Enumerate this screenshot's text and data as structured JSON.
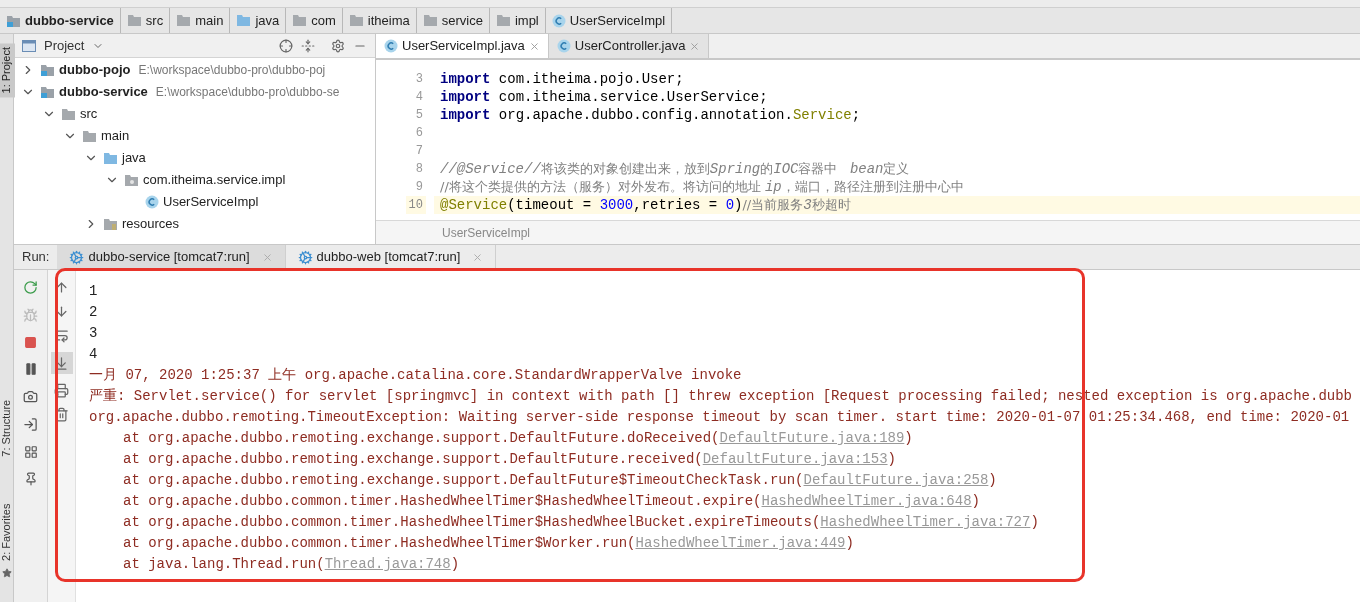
{
  "breadcrumb": [
    {
      "label": "dubbo-service",
      "kind": "module"
    },
    {
      "label": "src",
      "kind": "folder"
    },
    {
      "label": "main",
      "kind": "folder"
    },
    {
      "label": "java",
      "kind": "source"
    },
    {
      "label": "com",
      "kind": "folder"
    },
    {
      "label": "itheima",
      "kind": "folder"
    },
    {
      "label": "service",
      "kind": "folder"
    },
    {
      "label": "impl",
      "kind": "folder"
    },
    {
      "label": "UserServiceImpl",
      "kind": "class"
    }
  ],
  "tool_stripe": [
    {
      "label": "1: Project",
      "selected": true
    },
    {
      "label": "7: Structure",
      "selected": false
    },
    {
      "label": "2: Favorites",
      "selected": false
    }
  ],
  "project": {
    "title": "Project",
    "tree": [
      {
        "label": "dubbo-pojo",
        "path": "E:\\workspace\\dubbo-pro\\dubbo-poj",
        "kind": "module",
        "expanded": false
      },
      {
        "label": "dubbo-service",
        "path": "E:\\workspace\\dubbo-pro\\dubbo-se",
        "kind": "module",
        "expanded": true,
        "children": [
          {
            "label": "src",
            "kind": "folder",
            "expanded": true,
            "children": [
              {
                "label": "main",
                "kind": "folder",
                "expanded": true,
                "children": [
                  {
                    "label": "java",
                    "kind": "source",
                    "expanded": true,
                    "children": [
                      {
                        "label": "com.itheima.service.impl",
                        "kind": "package",
                        "expanded": true,
                        "children": [
                          {
                            "label": "UserServiceImpl",
                            "kind": "class"
                          }
                        ]
                      }
                    ]
                  },
                  {
                    "label": "resources",
                    "kind": "resources",
                    "expanded": false
                  }
                ]
              }
            ]
          }
        ]
      }
    ]
  },
  "editor": {
    "tabs": [
      {
        "label": "UserServiceImpl.java",
        "selected": true
      },
      {
        "label": "UserController.java",
        "selected": false
      }
    ],
    "lines": [
      {
        "number": "3",
        "current": false,
        "segments": [
          {
            "text": "import",
            "kind": "keyword"
          },
          {
            "text": " com.itheima.pojo.User;",
            "kind": "plain"
          }
        ]
      },
      {
        "number": "4",
        "current": false,
        "segments": [
          {
            "text": "import",
            "kind": "keyword"
          },
          {
            "text": " com.itheima.service.UserService;",
            "kind": "plain"
          }
        ]
      },
      {
        "number": "5",
        "current": false,
        "segments": [
          {
            "text": "import",
            "kind": "keyword"
          },
          {
            "text": " org.apache.dubbo.config.annotation.",
            "kind": "plain"
          },
          {
            "text": "Service",
            "kind": "annotation"
          },
          {
            "text": ";",
            "kind": "plain"
          }
        ]
      },
      {
        "number": "6",
        "current": false
      },
      {
        "number": "7",
        "current": false
      },
      {
        "number": "8",
        "current": false,
        "segments": [
          {
            "text": "//@Service//",
            "kind": "comment-italic"
          },
          {
            "text": "将该类的对象创建出来，放到",
            "kind": "comment"
          },
          {
            "text": "Spring",
            "kind": "comment-italic"
          },
          {
            "text": "的",
            "kind": "comment"
          },
          {
            "text": "IOC",
            "kind": "comment-italic"
          },
          {
            "text": "容器中   ",
            "kind": "comment"
          },
          {
            "text": "bean",
            "kind": "comment-italic"
          },
          {
            "text": "定义",
            "kind": "comment"
          }
        ]
      },
      {
        "number": "9",
        "current": false,
        "segments": [
          {
            "text": "//将这个类提供的方法（服务）对外发布。将访问的地址 ",
            "kind": "comment"
          },
          {
            "text": "ip",
            "kind": "comment-italic"
          },
          {
            "text": "，端口，路径注册到注册中心中",
            "kind": "comment"
          }
        ]
      },
      {
        "number": "10",
        "current": true,
        "segments": [
          {
            "text": "@Service",
            "kind": "annotation"
          },
          {
            "text": "(timeout = ",
            "kind": "plain"
          },
          {
            "text": "3000",
            "kind": "number"
          },
          {
            "text": ",retries = ",
            "kind": "plain"
          },
          {
            "text": "0",
            "kind": "number"
          },
          {
            "text": ")",
            "kind": "plain"
          },
          {
            "text": "//当前服务",
            "kind": "comment"
          },
          {
            "text": "3",
            "kind": "comment-italic"
          },
          {
            "text": "秒超时",
            "kind": "comment"
          }
        ]
      }
    ],
    "footer": "UserServiceImpl"
  },
  "run": {
    "label": "Run:",
    "tabs": [
      {
        "label": "dubbo-service [tomcat7:run]",
        "selected": true
      },
      {
        "label": "dubbo-web [tomcat7:run]",
        "selected": false
      }
    ],
    "scroll_to_end": true,
    "console": [
      {
        "kind": "output",
        "text": "1"
      },
      {
        "kind": "output",
        "text": "2"
      },
      {
        "kind": "output",
        "text": "3"
      },
      {
        "kind": "output",
        "text": "4"
      },
      {
        "kind": "error",
        "text": "一月 07, 2020 1:25:37 上午 org.apache.catalina.core.StandardWrapperValve invoke"
      },
      {
        "kind": "error",
        "text": "严重: Servlet.service() for servlet [springmvc] in context with path [] threw exception [Request processing failed; nested exception is org.apache.dubb"
      },
      {
        "kind": "error",
        "text": "org.apache.dubbo.remoting.TimeoutException: Waiting server-side response timeout by scan timer. start time: 2020-01-07 01:25:34.468, end time: 2020-01"
      },
      {
        "kind": "trace",
        "text": "at org.apache.dubbo.remoting.exchange.support.DefaultFuture.doReceived(",
        "link": "DefaultFuture.java:189",
        "after": ")"
      },
      {
        "kind": "trace",
        "text": "at org.apache.dubbo.remoting.exchange.support.DefaultFuture.received(",
        "link": "DefaultFuture.java:153",
        "after": ")"
      },
      {
        "kind": "trace",
        "text": "at org.apache.dubbo.remoting.exchange.support.DefaultFuture$TimeoutCheckTask.run(",
        "link": "DefaultFuture.java:258",
        "after": ")"
      },
      {
        "kind": "trace",
        "text": "at org.apache.dubbo.common.timer.HashedWheelTimer$HashedWheelTimeout.expire(",
        "link": "HashedWheelTimer.java:648",
        "after": ")"
      },
      {
        "kind": "trace",
        "text": "at org.apache.dubbo.common.timer.HashedWheelTimer$HashedWheelBucket.expireTimeouts(",
        "link": "HashedWheelTimer.java:727",
        "after": ")"
      },
      {
        "kind": "trace",
        "text": "at org.apache.dubbo.common.timer.HashedWheelTimer$Worker.run(",
        "link": "HashedWheelTimer.java:449",
        "after": ")"
      },
      {
        "kind": "trace",
        "text": "at java.lang.Thread.run(",
        "link": "Thread.java:748",
        "after": ")"
      }
    ]
  }
}
